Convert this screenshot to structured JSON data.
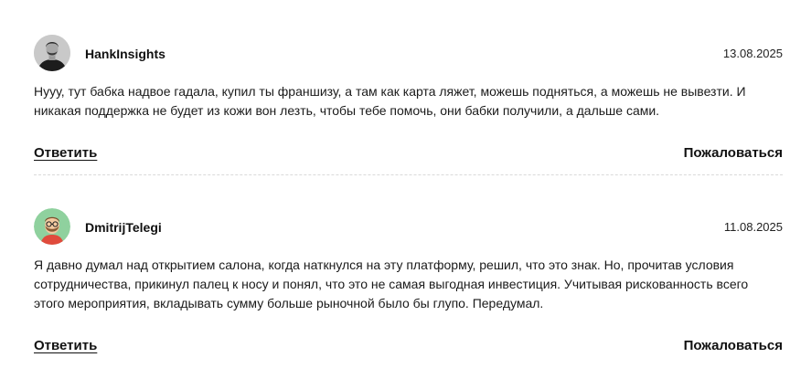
{
  "comments": [
    {
      "username": "HankInsights",
      "date": "13.08.2025",
      "avatar_icon": "user-photo-dark",
      "text": "Нууу, тут бабка надвое гадала, купил ты франшизу, а там как карта ляжет, можешь подняться, а можешь не вывезти. И никакая поддержка не будет из кожи вон лезть, чтобы тебе помочь, они бабки получили, а дальше сами.",
      "reply_label": "Ответить",
      "report_label": "Пожаловаться"
    },
    {
      "username": "DmitrijTelegi",
      "date": "11.08.2025",
      "avatar_icon": "cartoon-bearded-man-avatar",
      "text": "Я давно думал над открытием салона, когда наткнулся на эту платформу, решил, что это знак. Но, прочитав условия сотрудничества, прикинул палец к носу и понял, что это не самая выгодная инвестиция. Учитывая рискованность всего этого мероприятия, вкладывать сумму больше рыночной было бы глупо. Передумал.",
      "reply_label": "Ответить",
      "report_label": "Пожаловаться"
    }
  ],
  "colors": {
    "text": "#111111",
    "divider": "#d9d9d9",
    "avatar_2_bg": "#8fd19e"
  }
}
